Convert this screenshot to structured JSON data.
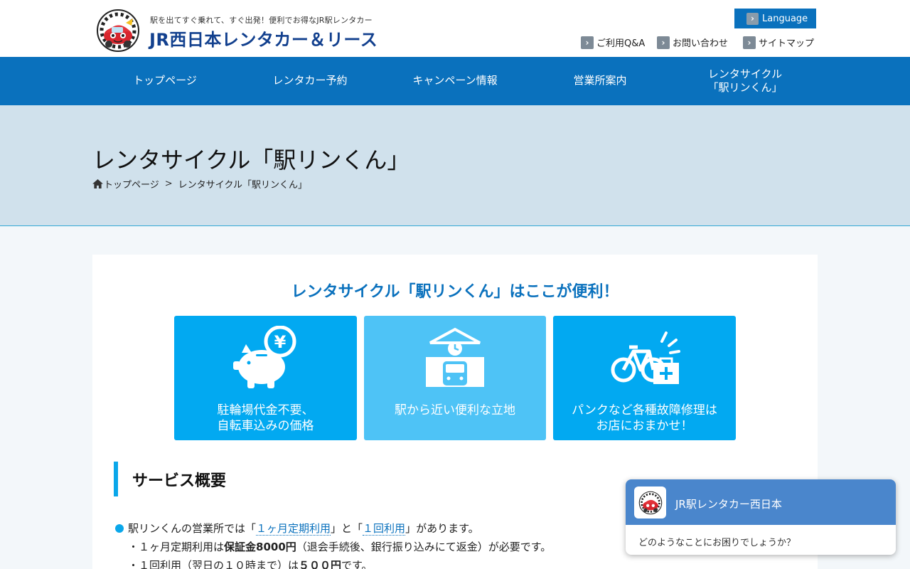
{
  "header": {
    "tagline": "駅を出てすぐ乗れて、すぐ出発！便利でお得なJR駅レンタカー",
    "brand": "JR西日本レンタカー＆リース",
    "logo_ring_text": "トレインレンタカーの旅",
    "language_label": "Language",
    "links": [
      {
        "label": "ご利用Q&A"
      },
      {
        "label": "お問い合わせ"
      },
      {
        "label": "サイトマップ"
      }
    ]
  },
  "nav": {
    "items": [
      {
        "label": "トップページ"
      },
      {
        "label": "レンタカー予約"
      },
      {
        "label": "キャンペーン情報"
      },
      {
        "label": "営業所案内"
      },
      {
        "label": "レンタサイクル\n「駅リンくん」"
      }
    ]
  },
  "page": {
    "title": "レンタサイクル「駅リンくん」",
    "breadcrumb": [
      {
        "label": "トップページ"
      },
      {
        "label": "レンタサイクル「駅リンくん」"
      }
    ],
    "breadcrumb_sep": ">"
  },
  "features": {
    "heading": "レンタサイクル「駅リンくん」はここが便利！",
    "tiles": [
      {
        "line1": "駐輪場代金不要、",
        "line2": "自転車込みの価格",
        "icon": "piggy-bank-yen-icon",
        "color": "#02a9f1"
      },
      {
        "line1": "駅から近い便利な立地",
        "line2": "",
        "icon": "station-train-icon",
        "color": "#4ec3f6"
      },
      {
        "line1": "パンクなど各種故障修理は",
        "line2": "お店におまかせ！",
        "icon": "bicycle-repair-icon",
        "color": "#02a9f1"
      }
    ]
  },
  "service": {
    "heading": "サービス概要",
    "intro_prefix": "駅リンくんの営業所では「",
    "intro_link1": "１ヶ月定期利用",
    "intro_mid": "」と「",
    "intro_link2": "１回利用",
    "intro_suffix": "」があります。",
    "line2_prefix": "・１ヶ月定期利用は",
    "line2_strong": "保証金8000円",
    "line2_suffix": "（退会手続後、銀行振り込みにて返金）が必要です。",
    "line3_prefix": "・１回利用（翌日の１０時まで）は",
    "line3_strong": "５００円",
    "line3_suffix": "です。"
  },
  "chat": {
    "title": "JR駅レンタカー西日本",
    "message": "どのようなことにお困りでしょうか？"
  },
  "colors": {
    "primary": "#0a71bd",
    "tile_dark": "#02a9f1",
    "tile_light": "#4ec3f6",
    "title_band": "#d0e1ec",
    "chat_header": "#4a86cc"
  }
}
